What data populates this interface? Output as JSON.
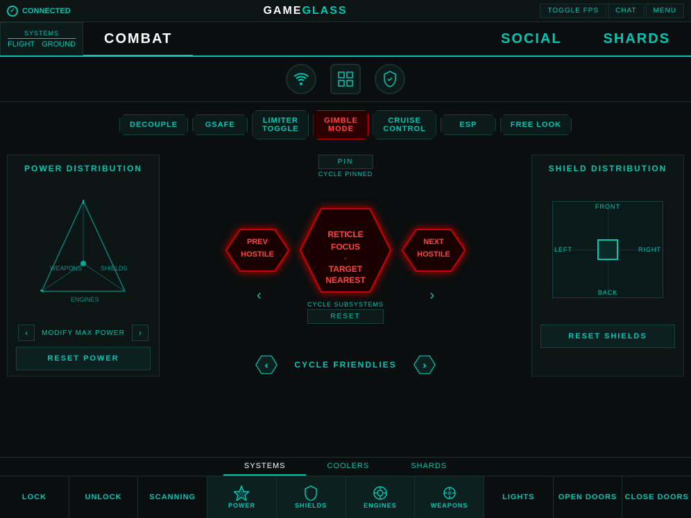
{
  "topBar": {
    "connected": "CONNECTED",
    "title_game": "GAME",
    "title_glass": "GLASS",
    "toggle_fps": "TOGGLE FPS",
    "chat": "CHAT",
    "menu": "MENU"
  },
  "nav": {
    "systems_label": "SYSTEMS",
    "flight": "FLIGHT",
    "ground": "GROUND",
    "combat": "COMBAT",
    "social": "SOCIAL",
    "shards": "SHARDS"
  },
  "icons": {
    "wifi": "wifi",
    "grid": "grid",
    "shield": "shield"
  },
  "modeButtons": [
    {
      "id": "decouple",
      "label": "DECOUPLE",
      "active": false
    },
    {
      "id": "gsafe",
      "label": "GSAFE",
      "active": false
    },
    {
      "id": "limiter-toggle",
      "label": "LIMITER\nTOGGLE",
      "active": false
    },
    {
      "id": "gimble-mode",
      "label": "GIMBLE\nMODE",
      "active": true
    },
    {
      "id": "cruise-control",
      "label": "CRUISE\nCONTROL",
      "active": false
    },
    {
      "id": "esp",
      "label": "ESP",
      "active": false
    },
    {
      "id": "free-look",
      "label": "FREE LOOK",
      "active": false
    }
  ],
  "powerPanel": {
    "title": "POWER DISTRIBUTION",
    "weapons_label": "WEAPONS",
    "shields_label": "SHIELDS",
    "engines_label": "ENGINES",
    "modify_label": "MODIFY MAX POWER",
    "reset_label": "RESET POWER"
  },
  "targeting": {
    "pin": "PIN",
    "cycle_pinned": "CYCLE PINNED",
    "reticle_focus": "RETICLE\nFOCUS",
    "dash": "-",
    "target_nearest": "TARGET\nNEAREST",
    "prev_hostile": "PREV\nHOSTILE",
    "next_hostile": "NEXT\nHOSTILE",
    "cycle_subsystems": "CYCLE SUBSYSTEMS",
    "reset": "RESET",
    "cycle_friendlies": "CYCLE FRIENDLIES"
  },
  "shieldPanel": {
    "title": "SHIELD DISTRIBUTION",
    "front": "FRONT",
    "back": "BACK",
    "left": "LEFT",
    "right": "RIGHT",
    "reset_label": "RESET SHIELDS"
  },
  "bottomTabs": [
    "SYSTEMS",
    "COOLERS",
    "SHARDS"
  ],
  "bottomActions": [
    {
      "id": "lock",
      "label": "LOCK",
      "icon": false
    },
    {
      "id": "unlock",
      "label": "UNLOCK",
      "icon": false
    },
    {
      "id": "scanning",
      "label": "SCANNING",
      "icon": false
    },
    {
      "id": "power",
      "label": "POWER",
      "icon": true,
      "symbol": "⚡"
    },
    {
      "id": "shields",
      "label": "SHIELDS",
      "icon": true,
      "symbol": "🛡"
    },
    {
      "id": "engines",
      "label": "ENGINES",
      "icon": true,
      "symbol": "⚙"
    },
    {
      "id": "weapons",
      "label": "WEAPONS",
      "icon": true,
      "symbol": "🎯"
    },
    {
      "id": "lights",
      "label": "LIGHTS",
      "icon": false
    },
    {
      "id": "open-doors",
      "label": "OPEN DOORS",
      "icon": false
    },
    {
      "id": "close-doors",
      "label": "CLOSE DOORS",
      "icon": false
    }
  ]
}
